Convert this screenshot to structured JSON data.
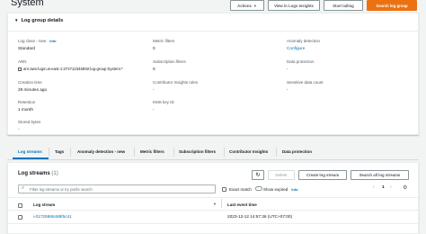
{
  "header": {
    "title": "System",
    "actions_label": "Actions",
    "insights_label": "View in Logs Insights",
    "tailing_label": "Start tailing",
    "search_label": "Search log group"
  },
  "details": {
    "title": "Log group details",
    "log_class_label": "Log class - new",
    "log_class_info": "Info",
    "log_class_value": "Standard",
    "arn_label": "ARN",
    "arn_value": "arn:aws:logs:us-east-1:274712346892:log-group:System:*",
    "creation_label": "Creation time",
    "creation_value": "29 minutes ago",
    "retention_label": "Retention",
    "retention_value": "1 month",
    "stored_label": "Stored bytes",
    "stored_value": "-",
    "metric_label": "Metric filters",
    "metric_value": "0",
    "subscription_label": "Subscription filters",
    "subscription_value": "0",
    "contributor_label": "Contributor Insights rules",
    "contributor_value": "-",
    "kms_label": "KMS key ID",
    "kms_value": "-",
    "anomaly_label": "Anomaly detection",
    "anomaly_value": "Configure",
    "protection_label": "Data protection",
    "protection_value": "-",
    "sensitive_label": "Sensitive data count",
    "sensitive_value": "-"
  },
  "tabs": [
    "Log streams",
    "Tags",
    "Anomaly detection - new",
    "Metric filters",
    "Subscription filters",
    "Contributor Insights",
    "Data protection"
  ],
  "streams": {
    "title": "Log streams",
    "count": "(1)",
    "delete_label": "Delete",
    "create_label": "Create log stream",
    "search_all_label": "Search all log streams",
    "filter_placeholder": "Filter log streams or try prefix search",
    "exact_label": "Exact match",
    "expired_label": "Show expired",
    "expired_info": "Info",
    "page": "1",
    "col_stream": "Log stream",
    "col_time": "Last event time",
    "rows": [
      {
        "name": "i-01725986489f5c41",
        "time": "2023-12-12 14:57:26 (UTC+07:00)"
      }
    ]
  },
  "colors": {
    "primary": "#ec7211",
    "link": "#0073bb"
  },
  "icons": [
    "refresh-icon",
    "search-icon",
    "copy-icon",
    "settings-icon",
    "sort-icon"
  ]
}
